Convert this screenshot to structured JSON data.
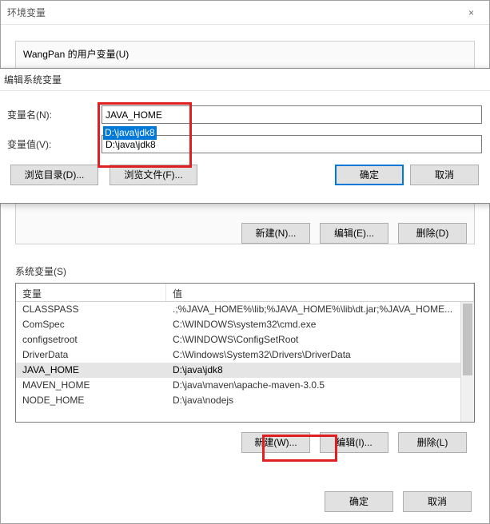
{
  "env_window": {
    "title": "环境变量",
    "close": "×"
  },
  "user_vars": {
    "label": "WangPan 的用户变量(U)",
    "new_btn": "新建(N)...",
    "edit_btn": "编辑(E)...",
    "delete_btn": "删除(D)"
  },
  "edit_dialog": {
    "title": "编辑系统变量",
    "name_label": "变量名(N):",
    "name_value": "JAVA_HOME",
    "value_label": "变量值(V):",
    "value_value": "D:\\java\\jdk8",
    "browse_dir_btn": "浏览目录(D)...",
    "browse_file_btn": "浏览文件(F)...",
    "ok_btn": "确定",
    "cancel_btn": "取消"
  },
  "sys_vars": {
    "label": "系统变量(S)",
    "col_name": "变量",
    "col_value": "值",
    "rows": [
      {
        "name": "CLASSPASS",
        "value": ".;%JAVA_HOME%\\lib;%JAVA_HOME%\\lib\\dt.jar;%JAVA_HOME..."
      },
      {
        "name": "ComSpec",
        "value": "C:\\WINDOWS\\system32\\cmd.exe"
      },
      {
        "name": "configsetroot",
        "value": "C:\\WINDOWS\\ConfigSetRoot"
      },
      {
        "name": "DriverData",
        "value": "C:\\Windows\\System32\\Drivers\\DriverData"
      },
      {
        "name": "JAVA_HOME",
        "value": "D:\\java\\jdk8",
        "selected": true
      },
      {
        "name": "MAVEN_HOME",
        "value": "D:\\java\\maven\\apache-maven-3.0.5"
      },
      {
        "name": "NODE_HOME",
        "value": "D:\\java\\nodejs"
      }
    ],
    "new_btn": "新建(W)...",
    "edit_btn": "编辑(I)...",
    "delete_btn": "删除(L)"
  },
  "footer": {
    "ok_btn": "确定",
    "cancel_btn": "取消"
  }
}
